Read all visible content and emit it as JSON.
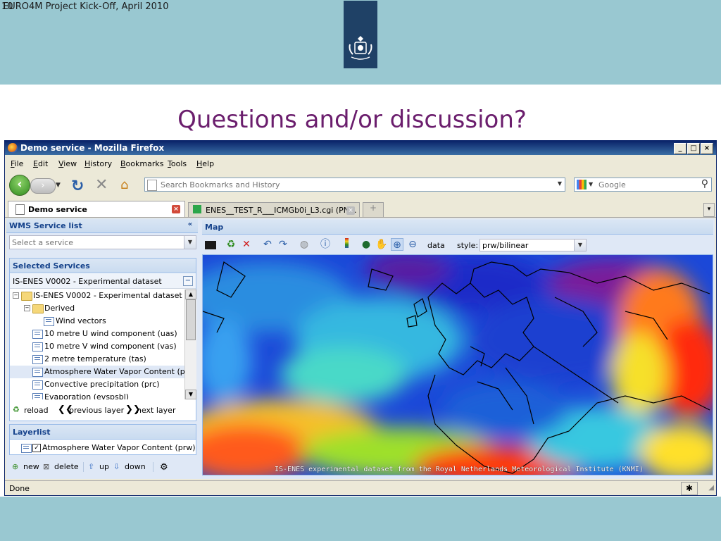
{
  "slide": {
    "header_text": "EURO4M Project Kick-Off, April 2010",
    "page_number": "10",
    "title": "Questions and/or discussion?"
  },
  "window": {
    "title": "Demo service - Mozilla Firefox",
    "buttons": [
      "_",
      "□",
      "×"
    ]
  },
  "menu": [
    "File",
    "Edit",
    "View",
    "History",
    "Bookmarks",
    "Tools",
    "Help"
  ],
  "navbar": {
    "url_placeholder": "Search Bookmarks and History",
    "search_placeholder": "Google"
  },
  "tabs": {
    "active": "Demo service",
    "second": "ENES__TEST_R___ICMGb0i_L3.cgi (PN..."
  },
  "wms": {
    "panel_title": "WMS Service list",
    "select_placeholder": "Select a service",
    "selected_title": "Selected Services",
    "dataset": "IS-ENES V0002 - Experimental dataset",
    "tree": [
      "IS-ENES V0002 - Experimental dataset",
      "Derived",
      "Wind vectors",
      "10 metre U wind component (uas)",
      "10 metre V wind component (vas)",
      "2 metre temperature (tas)",
      "Atmosphere Water Vapor Content (prw)",
      "Convective precipitation (prc)",
      "Evaporation (evspsbl)"
    ],
    "reload": "reload",
    "previous": "previous layer",
    "next": "next layer"
  },
  "layerlist": {
    "title": "Layerlist",
    "layer": "Atmosphere Water Vapor Content (prw)",
    "new": "new",
    "delete": "delete",
    "up": "up",
    "down": "down"
  },
  "map": {
    "title": "Map",
    "data_label": "data",
    "style_label": "style:",
    "style_value": "prw/bilinear",
    "caption": "IS-ENES experimental dataset from the Royal Netherlands Meteorological Institute (KNMI)"
  },
  "status": {
    "text": "Done"
  },
  "colors": {
    "slide_band": "#99c8d1",
    "title_purple": "#6b1e6d",
    "ext_blue": "#15428b",
    "titlebar": "#0a246a"
  }
}
